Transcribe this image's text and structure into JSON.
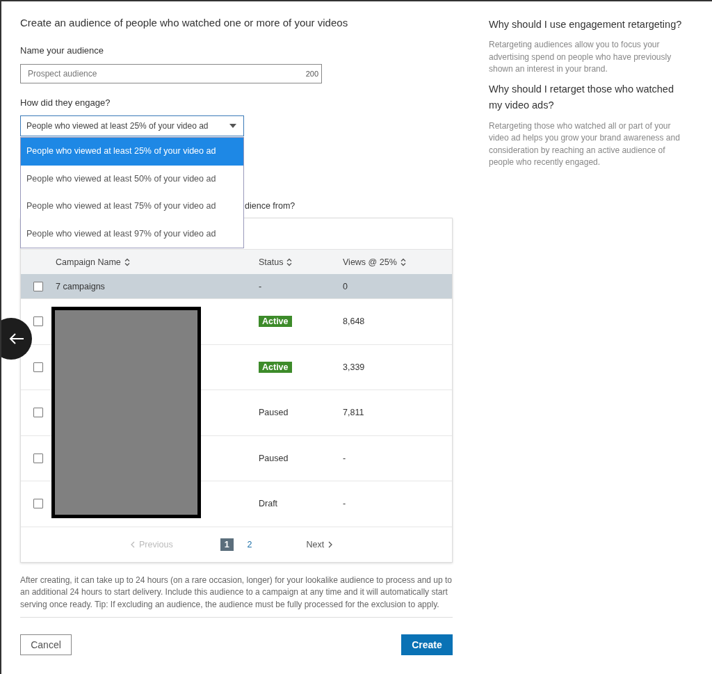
{
  "title": "Create an audience of people who watched one or more of your videos",
  "name_field": {
    "label": "Name your audience",
    "placeholder": "Prospect audience",
    "counter": "200"
  },
  "engage": {
    "label": "How did they engage?",
    "value": "People who viewed at least 25% of your video ad",
    "expanded": true,
    "options": [
      {
        "label": "People who viewed at least 25% of your video ad",
        "selected": true
      },
      {
        "label": "People who viewed at least 50% of your video ad",
        "selected": false
      },
      {
        "label": "People who viewed at least 75% of your video ad",
        "selected": false
      },
      {
        "label": "People who viewed at least 97% of your video ad",
        "selected": false
      }
    ]
  },
  "campaigns_label": "dience from?",
  "table": {
    "columns": [
      "Campaign Name",
      "Status",
      "Views @ 25%"
    ],
    "summary": {
      "name": "7 campaigns",
      "status": "-",
      "views": "0",
      "checked": false
    },
    "rows": [
      {
        "status": "Active",
        "kind": "badge",
        "views": "8,648",
        "checked": false
      },
      {
        "status": "Active",
        "kind": "badge",
        "views": "3,339",
        "checked": false
      },
      {
        "status": "Paused",
        "kind": "plain",
        "views": "7,811",
        "checked": false
      },
      {
        "status": "Paused",
        "kind": "plain",
        "views": "-",
        "checked": false
      },
      {
        "status": "Draft",
        "kind": "plain",
        "views": "-",
        "checked": false
      }
    ]
  },
  "pagination": {
    "previous": "Previous",
    "next": "Next",
    "pages": [
      {
        "label": "1",
        "selected": true
      },
      {
        "label": "2",
        "selected": false
      }
    ]
  },
  "note": "After creating, it can take up to 24 hours (on a rare occasion, longer) for your lookalike audience to process and up to an additional 24 hours to start delivery. Include this audience to a campaign at any time and it will automatically start serving once ready. Tip: If excluding an audience, the audience must be fully processed for the exclusion to apply.",
  "buttons": {
    "cancel": "Cancel",
    "create": "Create"
  },
  "help": [
    {
      "heading": "Why should I use engagement retargeting?",
      "text": "Retargeting audiences allow you to focus your advertising spend on people who have previously shown an interest in your brand."
    },
    {
      "heading": "Why should I retarget those who watched my video ads?",
      "text": "Retargeting those who watched all or part of your video ad helps you grow your brand awareness and consideration by reaching an active audience of people who recently engaged."
    }
  ]
}
